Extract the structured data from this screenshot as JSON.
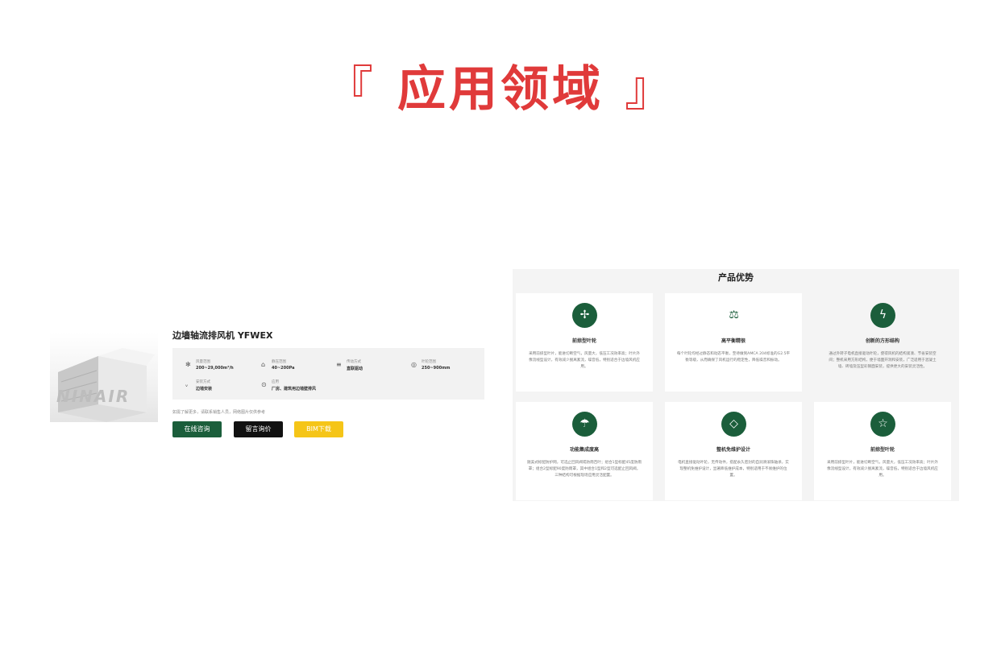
{
  "hero": {
    "open_bracket": "『",
    "title": "应用领域",
    "close_bracket": "』"
  },
  "product": {
    "logo": "NINAIR",
    "title": "边墙轴流排风机 YFWEX",
    "specs": [
      {
        "icon": "fan-icon",
        "label": "风量范围",
        "value": "200~29,000m³/h"
      },
      {
        "icon": "pressure-icon",
        "label": "静压范围",
        "value": "40~200Pa"
      },
      {
        "icon": "drive-icon",
        "label": "传动方式",
        "value": "直联驱动"
      },
      {
        "icon": "diameter-icon",
        "label": "叶轮范围",
        "value": "250~900mm"
      },
      {
        "icon": "install-icon",
        "label": "安装方式",
        "value": "边墙安装"
      },
      {
        "icon": "application-icon",
        "label": "应用",
        "value": "厂房、建筑用边墙壁排风"
      }
    ],
    "note": "如需了解更多，请联系销售人员，网络图片仅供参考",
    "buttons": {
      "consult": "在线咨询",
      "quote": "留言询价",
      "bim": "BIM下载"
    },
    "colors": {
      "primary": "#1b5e3b",
      "dark": "#111111",
      "accent": "#f5c518"
    }
  },
  "advantages": {
    "title": "产品优势",
    "cards": [
      {
        "icon": "impeller-icon",
        "glyph": "✢",
        "title": "前掠型叶轮",
        "desc": "采用前掠型叶片，能进切断空气，风量大，低压工况效率高；叶片外像流线型设计，有效减少脱离紊流，噪音低，特别适合于边墙风机应用。"
      },
      {
        "icon": "balance-icon",
        "glyph": "⚖",
        "title": "高平衡精很",
        "desc": "每个叶轮均经过静态和动态平衡，至待做到AMCA 204标准的G2.5平衡等级，从而确保了风机运行的稳定性，降低噪音和振动。"
      },
      {
        "icon": "lightning-icon",
        "glyph": "ϟ",
        "title": "创新的方形结构",
        "desc": "通过外转子电机直接驱动叶轮，使得风机的结构紧凑、节省安装空间；整机采用方形结构，便于墙面开洞和安装，广泛适用于混凝土墙、砖墙及压型彩钢面安装，提供更大的安装灵活性。"
      },
      {
        "icon": "umbrella-icon",
        "glyph": "☂",
        "title": "功能集成度高",
        "desc": "随美式标配防护网，可选止回风阀或防雨百叶；组合1型标配45度防雨罩；组合2型标配90度防雨罩，其中组合1型和2型可选配止回风阀，三种结构可根据现场应用灵活配置。"
      },
      {
        "icon": "diamond-icon",
        "glyph": "◇",
        "title": "整机免维护设计",
        "desc": "电机直接驱动叶轮，无传动件，搭配永久密封的自润滑滚珠轴承，实现整机免维护设计，显著降低维护成本，特别适用于不易维护的位置。"
      },
      {
        "icon": "star-icon",
        "glyph": "☆",
        "title": "前掠型叶轮",
        "desc": "采用前掠型叶片，能进切断空气，风量大，低压工况效率高；叶片外像流线型设计，有效减少脱离紊流，噪音低，特别适合于边墙风机应用。"
      }
    ]
  }
}
